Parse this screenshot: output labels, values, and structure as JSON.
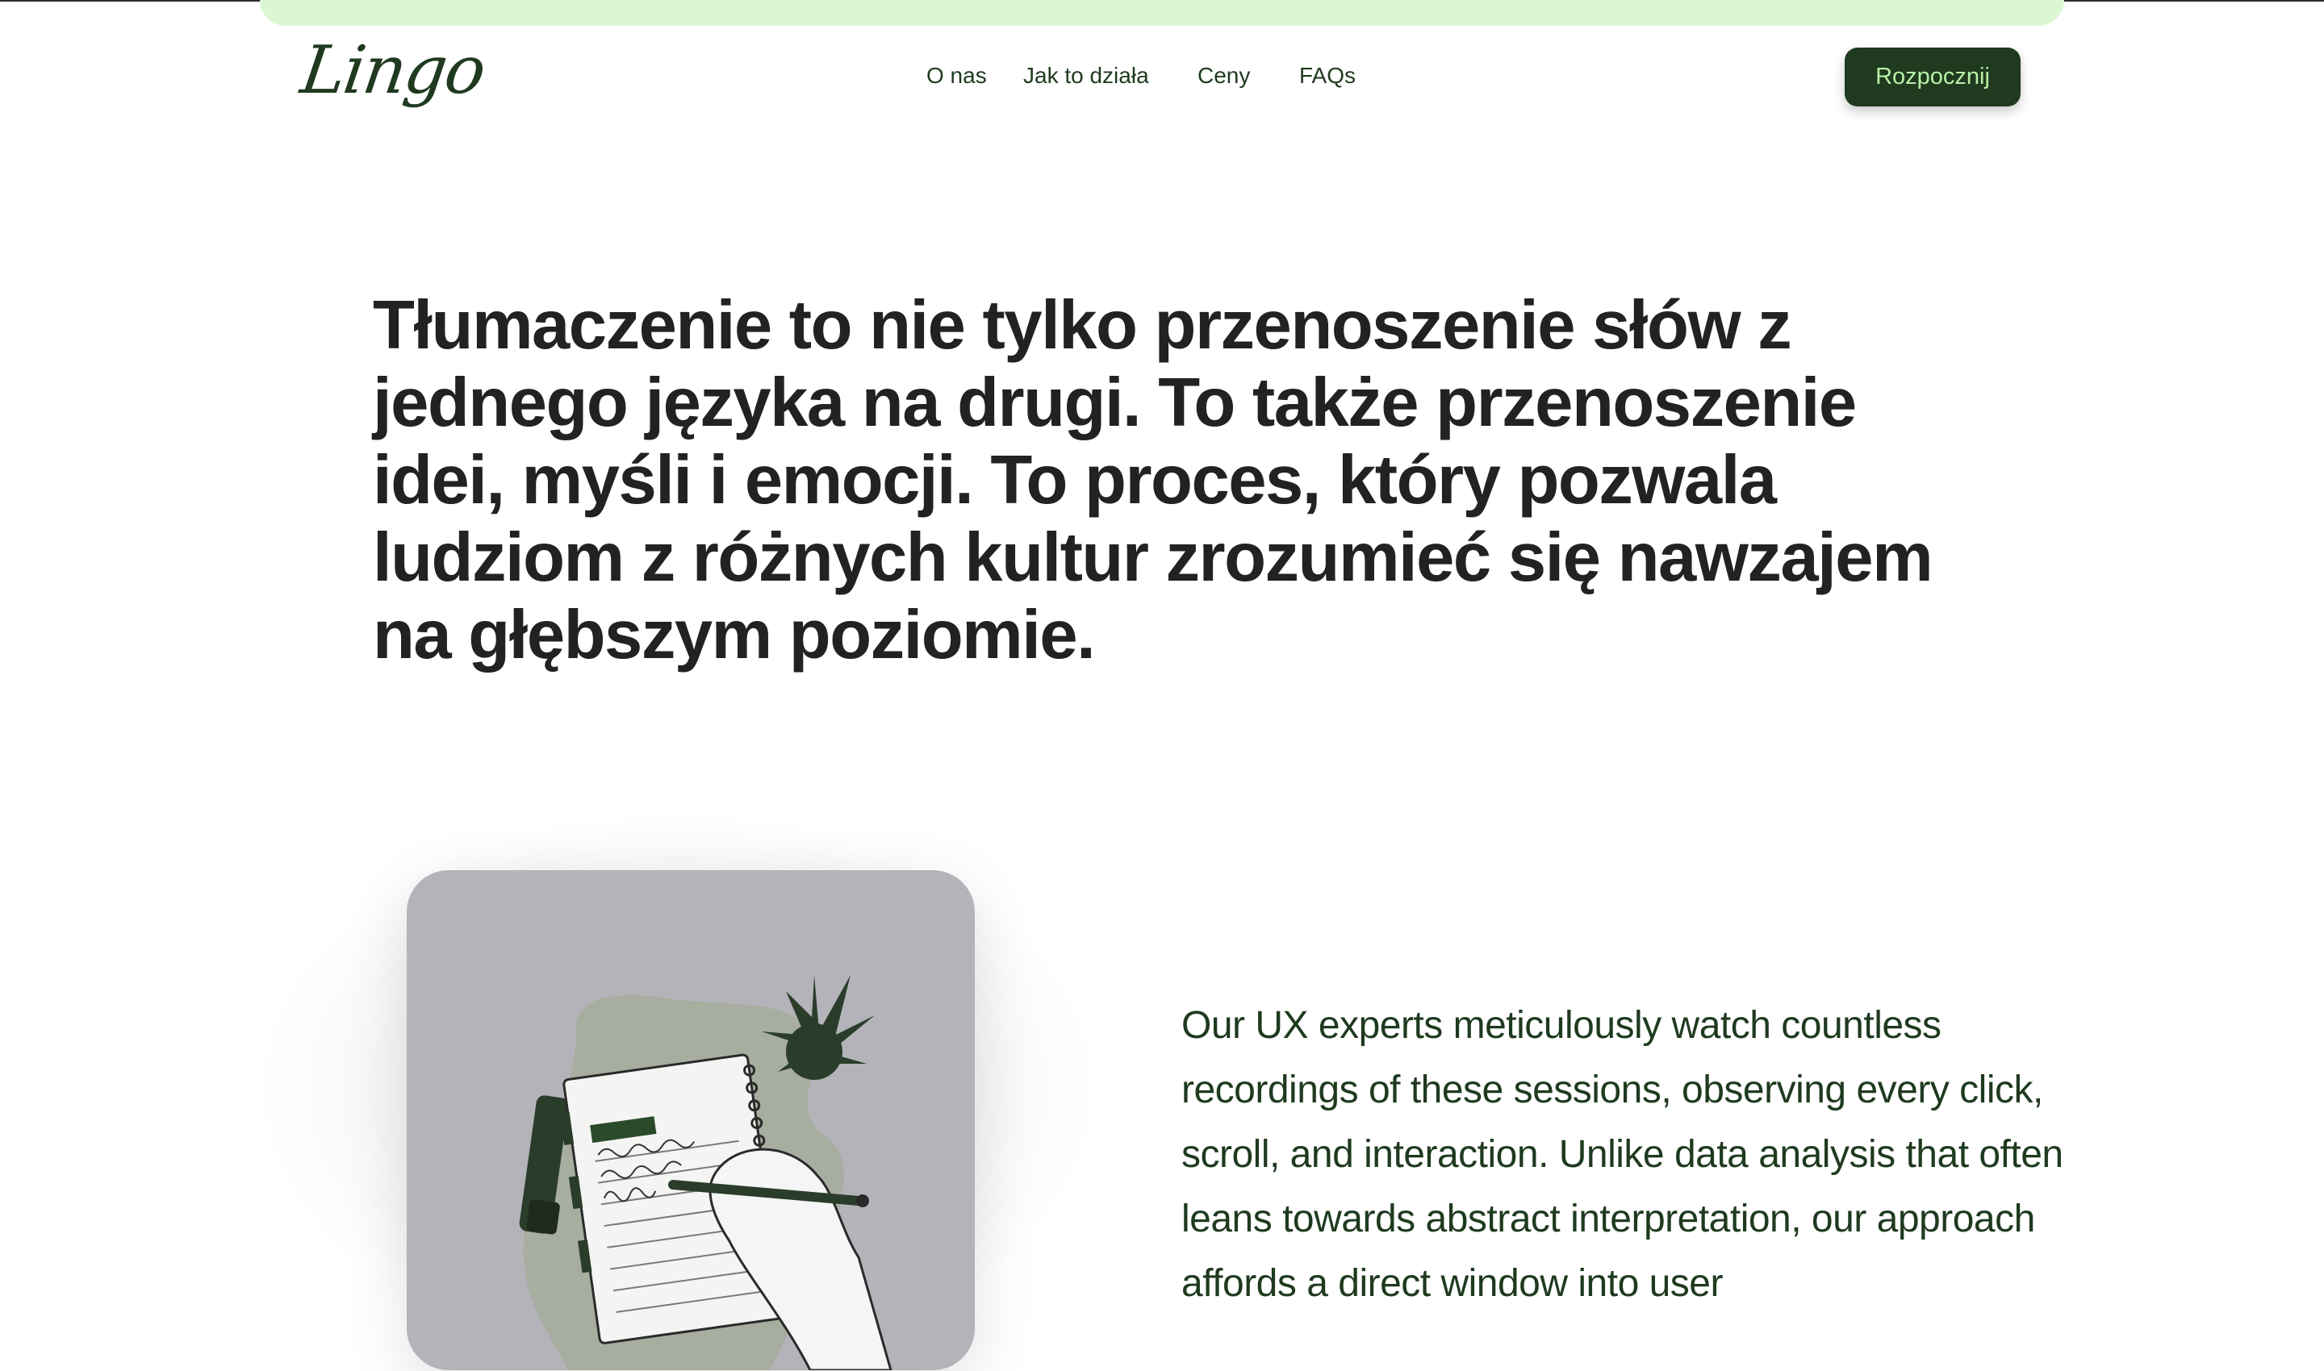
{
  "brand": {
    "logo_text": "Lingo"
  },
  "nav": {
    "items": [
      {
        "label": "O nas"
      },
      {
        "label": "Jak to działa"
      },
      {
        "label": "Ceny"
      },
      {
        "label": "FAQs"
      }
    ],
    "cta_label": "Rozpocznij"
  },
  "hero": {
    "headline": "Tłumaczenie to nie tylko przenoszenie słów z jednego języka na drugi. To także przenoszenie idei, myśli i emocji. To proces, który pozwala ludziom z różnych kultur zrozumieć się nawzajem na głębszym poziomie."
  },
  "feature": {
    "illustration": "hand-writing-notebook-illustration",
    "text": "Our UX experts meticulously watch countless recordings of these sessions, observing every click, scroll, and interaction. Unlike data analysis that often leans towards abstract interpretation, our approach affords a direct window into user"
  },
  "colors": {
    "brand_dark": "#1f3a1f",
    "accent_light_green": "#daf7d2",
    "cta_text": "#b9f0a6",
    "card_bg": "#b4b3ba",
    "heading": "#222222"
  }
}
